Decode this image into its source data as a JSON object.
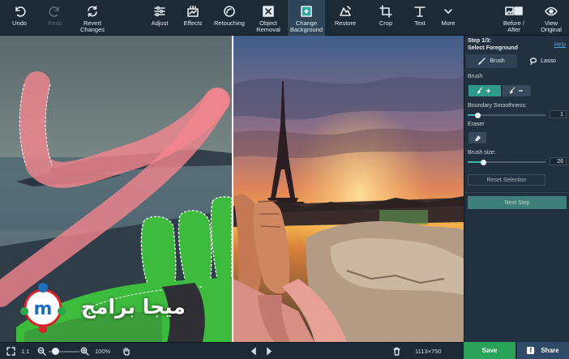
{
  "toolbar": {
    "undo": "Undo",
    "redo": "Redo",
    "revert_line1": "Revert",
    "revert_line2": "Changes",
    "adjust": "Adjust",
    "effects": "Effects",
    "retouching": "Retouching",
    "object_line1": "Object",
    "object_line2": "Removal",
    "change_line1": "Change",
    "change_line2": "Background",
    "restore": "Restore",
    "crop": "Crop",
    "text": "Text",
    "more": "More",
    "before_line1": "Before /",
    "before_line2": "After",
    "view_line1": "View",
    "view_line2": "Original"
  },
  "panel": {
    "step_line1": "Step 1/3:",
    "step_line2": "Select Foreground",
    "help": "Help",
    "tab_brush": "Brush",
    "tab_lasso": "Lasso",
    "brush_label": "Brush",
    "boundary_label": "Boundary Smoothness:",
    "boundary_value": "1",
    "eraser_label": "Eraser",
    "brush_size_label": "Brush size:",
    "brush_size_value": "26",
    "reset": "Reset Selection",
    "next": "Next Step"
  },
  "levels": {
    "boundary_fraction": 0.12,
    "brush_size_fraction": 0.2,
    "zoom_fraction": 0.2
  },
  "bottom": {
    "fit": "1:1",
    "zoom": "100%",
    "dimensions": "1113×750",
    "save": "Save",
    "share": "Share",
    "facebook": "f"
  },
  "watermark": {
    "text": "ميجا برامج",
    "logo_letter": "m"
  },
  "colors": {
    "accent": "#2f9a8c",
    "save": "#29a35a",
    "share": "#2e4a66",
    "selection_overlay": "#f2858f",
    "foreground_mask": "#3dbb3d"
  },
  "icons": {
    "undo": "undo-icon",
    "redo": "redo-icon",
    "revert": "revert-icon",
    "adjust": "sliders-icon",
    "effects": "effects-icon",
    "retouching": "retouch-icon",
    "object_removal": "object-removal-icon",
    "change_background": "change-background-icon",
    "restore": "restore-icon",
    "crop": "crop-icon",
    "text": "text-icon",
    "more": "chevron-down-icon",
    "before_after": "before-after-icon",
    "view_original": "eye-icon"
  }
}
